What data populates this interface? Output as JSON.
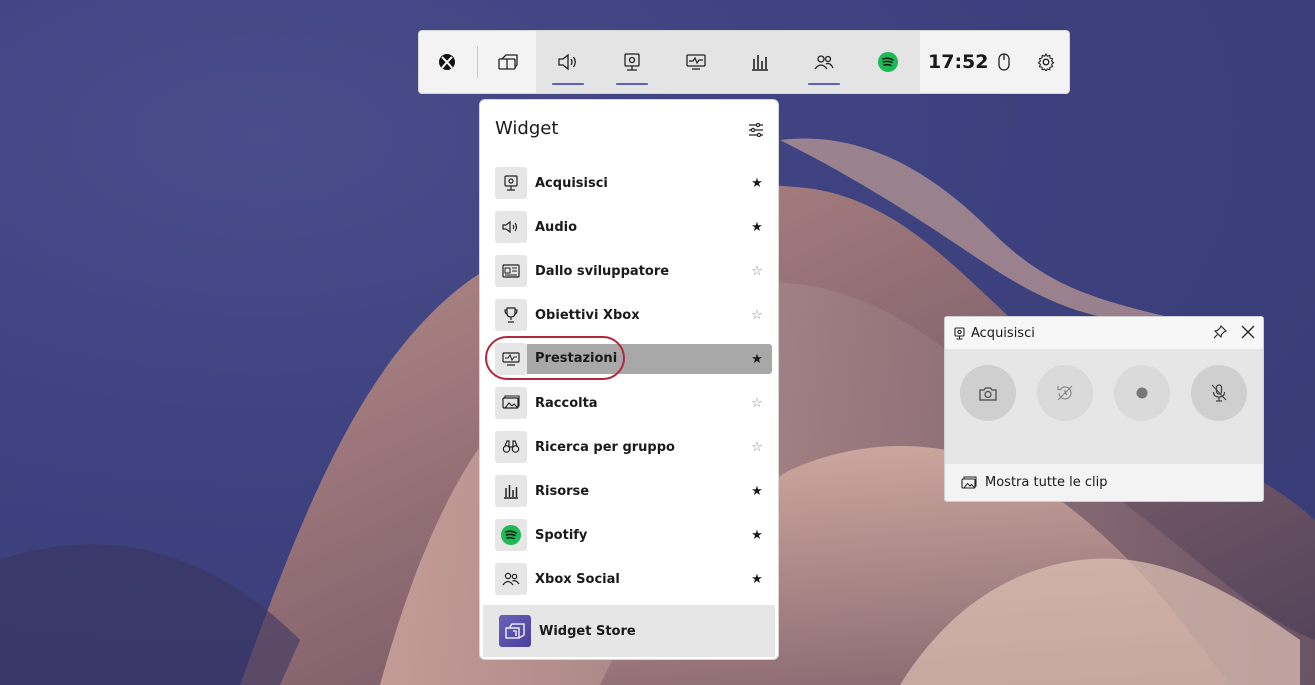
{
  "topbar": {
    "time": "17:52"
  },
  "widget_panel": {
    "title": "Widget",
    "items": [
      {
        "label": "Acquisisci",
        "favorite": true,
        "icon": "capture-icon"
      },
      {
        "label": "Audio",
        "favorite": true,
        "icon": "audio-icon"
      },
      {
        "label": "Dallo sviluppatore",
        "favorite": false,
        "icon": "news-icon"
      },
      {
        "label": "Obiettivi Xbox",
        "favorite": false,
        "icon": "trophy-icon"
      },
      {
        "label": "Prestazioni",
        "favorite": true,
        "icon": "performance-icon"
      },
      {
        "label": "Raccolta",
        "favorite": false,
        "icon": "gallery-icon"
      },
      {
        "label": "Ricerca per gruppo",
        "favorite": false,
        "icon": "binoculars-icon"
      },
      {
        "label": "Risorse",
        "favorite": true,
        "icon": "resources-icon"
      },
      {
        "label": "Spotify",
        "favorite": true,
        "icon": "spotify-icon"
      },
      {
        "label": "Xbox Social",
        "favorite": true,
        "icon": "social-icon"
      }
    ],
    "store_label": "Widget Store"
  },
  "capture_widget": {
    "title": "Acquisisci",
    "footer_label": "Mostra tutte le clip"
  },
  "colors": {
    "accent": "#5b5fc7",
    "highlight_ring": "#b0283a",
    "spotify": "#1db954"
  }
}
